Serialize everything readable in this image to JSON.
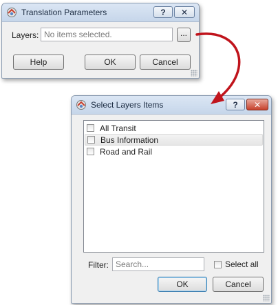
{
  "translation_dialog": {
    "title": "Translation Parameters",
    "help_tb": "?",
    "close_tb": "✕",
    "layers_label": "Layers:",
    "layers_placeholder": "No items selected.",
    "browse_label": "...",
    "help_label": "Help",
    "ok_label": "OK",
    "cancel_label": "Cancel"
  },
  "select_dialog": {
    "title": "Select Layers Items",
    "help_tb": "?",
    "close_tb": "✕",
    "items": [
      {
        "label": "All Transit",
        "checked": false
      },
      {
        "label": "Bus Information",
        "checked": false
      },
      {
        "label": "Road and Rail",
        "checked": false
      }
    ],
    "filter_label": "Filter:",
    "filter_placeholder": "Search...",
    "select_all_label": "Select all",
    "ok_label": "OK",
    "cancel_label": "Cancel"
  },
  "colors": {
    "arrow": "#c0141c"
  },
  "icons": [
    "app-icon",
    "help-icon",
    "close-icon",
    "size-grip-icon",
    "arrow-connector-icon"
  ]
}
